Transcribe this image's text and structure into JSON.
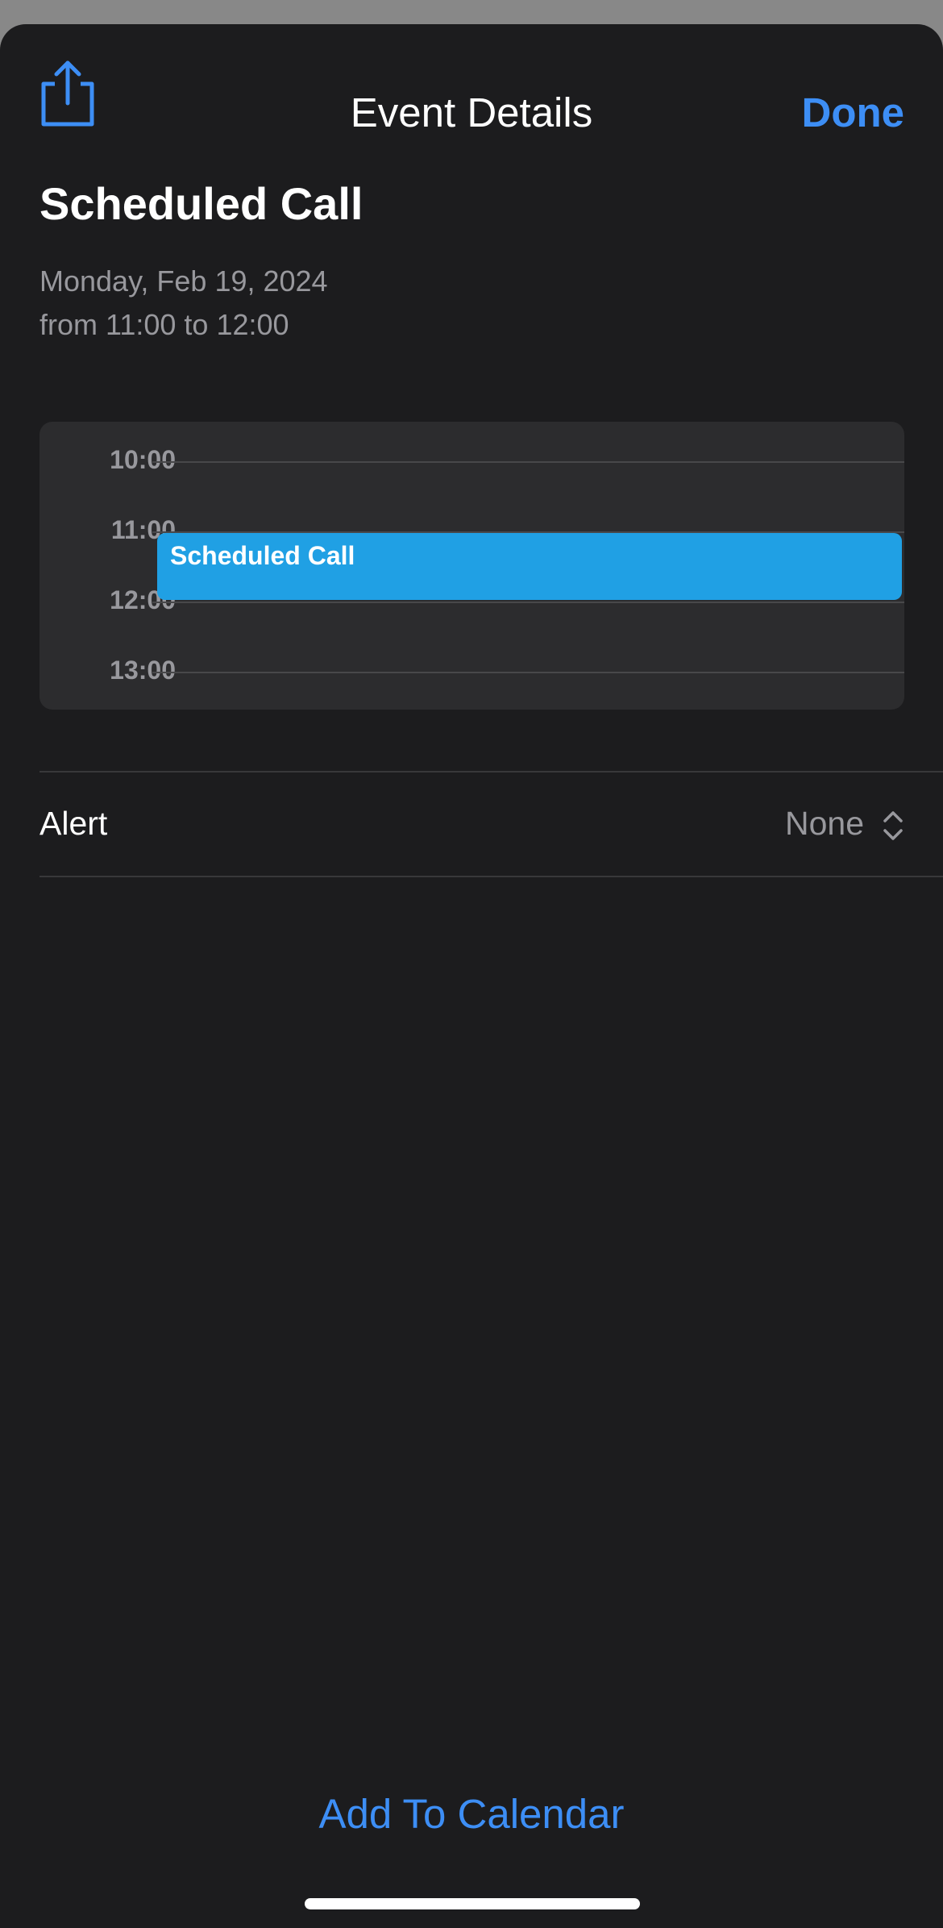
{
  "nav": {
    "title": "Event Details",
    "done_label": "Done",
    "share_icon": "share-icon"
  },
  "event": {
    "title": "Scheduled Call",
    "date": "Monday, Feb 19, 2024",
    "time_range": "from 11:00 to 12:00"
  },
  "timeline": {
    "hours": [
      "10:00",
      "11:00",
      "12:00",
      "13:00"
    ],
    "event_label": "Scheduled Call",
    "event_start_hour": 11,
    "event_end_hour": 12,
    "event_color": "#20a0e4"
  },
  "alert": {
    "label": "Alert",
    "value": "None",
    "icon": "chevron-up-down-icon"
  },
  "footer": {
    "add_label": "Add To Calendar"
  },
  "colors": {
    "accent": "#3d8ef5",
    "background": "#1c1c1e",
    "card": "#2c2c2e"
  }
}
